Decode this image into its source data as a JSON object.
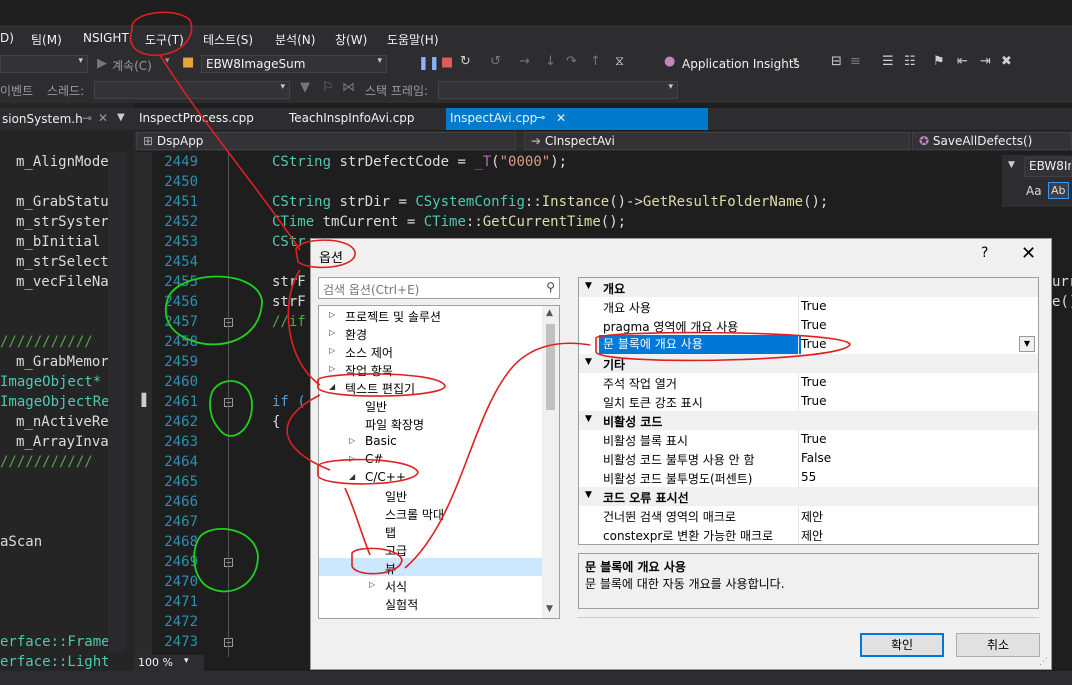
{
  "menubar": {
    "items": [
      "D)",
      "팀(M)",
      "NSIGHT",
      "도구(T)",
      "테스트(S)",
      "분석(N)",
      "창(W)",
      "도움말(H)"
    ]
  },
  "toolbar1": {
    "continue_label": "계속(C)",
    "project_combo": "EBW8ImageSum",
    "app_insights": "Application Insights"
  },
  "toolbar2": {
    "event_label": "이벤트",
    "thread_label": "스레드:",
    "stack_frame_label": "스택 프레임:"
  },
  "left_panel": {
    "tab_title": "sionSystem.h",
    "lines": [
      "m_AlignMode",
      "",
      "m_GrabStatu",
      "m_strSyster",
      "m_bInitial",
      "m_strSelect",
      "m_vecFileNa",
      "",
      "",
      "///////////",
      "m_GrabMemor",
      "ImageObject*",
      "ImageObjectRe",
      "m_nActiveRe",
      "m_ArrayInva",
      "///////////",
      "",
      "",
      "",
      "aScan",
      "",
      "",
      "",
      "",
      "erface::Frame",
      "erface::Light"
    ]
  },
  "doc_tabs": [
    "InspectProcess.cpp",
    "TeachInspInfoAvi.cpp",
    "InspectAvi.cpp"
  ],
  "navbar": {
    "project": "DspApp",
    "class": "CInspectAvi",
    "method": "SaveAllDefects()"
  },
  "find_panel": {
    "text": "EBW8Im"
  },
  "editor": {
    "line_numbers": [
      "2449",
      "2450",
      "2451",
      "2452",
      "2453",
      "2454",
      "2455",
      "2456",
      "2457",
      "2458",
      "2459",
      "2460",
      "2461",
      "2462",
      "2463",
      "2464",
      "2465",
      "2466",
      "2467",
      "2468",
      "2469",
      "2470",
      "2471",
      "2472",
      "2473"
    ],
    "zoom": "100 %"
  },
  "dialog": {
    "title": "옵션",
    "help": "?",
    "close": "✕",
    "search_placeholder": "검색 옵션(Ctrl+E)",
    "tree": [
      "프로젝트 및 솔루션",
      "환경",
      "소스 제어",
      "작업 항목",
      "텍스트 편집기",
      "일반",
      "파일 확장명",
      "Basic",
      "C#",
      "C/C++",
      "일반",
      "스크롤 막대",
      "탭",
      "고급",
      "뷰",
      "서식",
      "실험적"
    ],
    "categories": {
      "outline": "개요",
      "misc": "기타",
      "inactive": "비활성 코드",
      "squiggles": "코드 오류 표시선"
    },
    "props": [
      {
        "name": "개요 사용",
        "value": "True"
      },
      {
        "name": "pragma 영역에 개요 사용",
        "value": "True"
      },
      {
        "name": "문 블록에 개요 사용",
        "value": "True"
      },
      {
        "name": "주석 작업 열거",
        "value": "True"
      },
      {
        "name": "일치 토큰 강조 표시",
        "value": "True"
      },
      {
        "name": "비활성 블록 표시",
        "value": "True"
      },
      {
        "name": "비활성 코드 불투명 사용 안 함",
        "value": "False"
      },
      {
        "name": "비활성 코드 불투명도(퍼센트)",
        "value": "55"
      },
      {
        "name": "건너뛴 검색 영역의 매크로",
        "value": "제안"
      },
      {
        "name": "constexpr로 변환 가능한 매크로",
        "value": "제안"
      }
    ],
    "desc_title": "문 블록에 개요 사용",
    "desc_body": "문 블록에 대한 자동 개요를 사용합니다.",
    "ok": "확인",
    "cancel": "취소"
  }
}
